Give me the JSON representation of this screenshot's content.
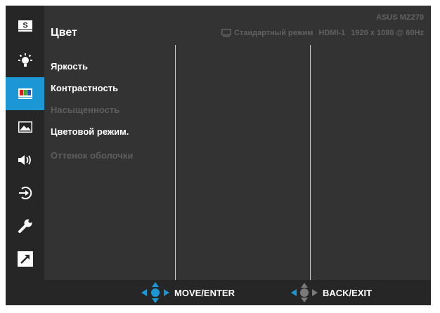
{
  "colors": {
    "accent": "#1c97d6",
    "panel": "#333333",
    "sidebar": "#262626",
    "text": "#ffffff",
    "disabled_text": "#5e5e5e",
    "status_text": "#616161",
    "icon_white": "#ffffff"
  },
  "sidebar": {
    "items": [
      {
        "icon": "splendid-icon",
        "glyph": "S",
        "active": false
      },
      {
        "icon": "brightness-icon",
        "active": false
      },
      {
        "icon": "color-icon",
        "active": true
      },
      {
        "icon": "image-icon",
        "active": false
      },
      {
        "icon": "sound-icon",
        "active": false
      },
      {
        "icon": "input-select-icon",
        "active": false
      },
      {
        "icon": "system-setup-icon",
        "active": false
      },
      {
        "icon": "shortcut-icon",
        "active": false
      }
    ]
  },
  "header": {
    "title": "Цвет",
    "model": "ASUS MZ279",
    "status": {
      "mode": "Стандартный режим",
      "input": "HDMI-1",
      "resolution": "1920 x 1080 @ 60Hz"
    }
  },
  "menu": {
    "items": [
      {
        "label": "Яркость",
        "enabled": true
      },
      {
        "label": "Контрастность",
        "enabled": true
      },
      {
        "label": "Насыщенность",
        "enabled": false
      },
      {
        "label": "Цветовой режим.",
        "enabled": true
      },
      {
        "label": "Оттенок оболочки",
        "enabled": false
      }
    ]
  },
  "footer": {
    "move_enter": "MOVE/ENTER",
    "back_exit": "BACK/EXIT"
  }
}
